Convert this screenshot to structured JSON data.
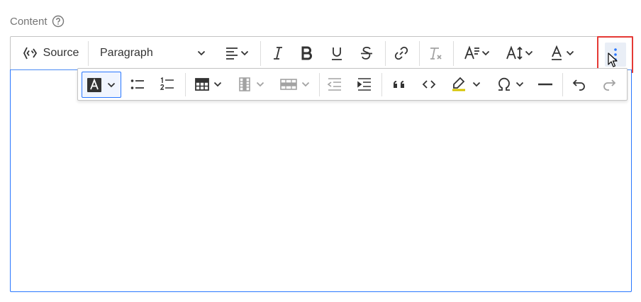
{
  "field": {
    "label": "Content",
    "help_icon": "question-circle-icon"
  },
  "toolbar": {
    "source_label": "Source",
    "heading_value": "Paragraph",
    "items": [
      "source-editing",
      "heading",
      "alignment",
      "italic",
      "bold",
      "underline",
      "strikethrough",
      "link",
      "remove-format",
      "font-family",
      "font-size",
      "font-color",
      "show-more-items"
    ]
  },
  "overflow_toolbar": {
    "items": [
      "font-background-color",
      "bulleted-list",
      "numbered-list",
      "insert-table",
      "table-column",
      "table-row",
      "outdent",
      "indent",
      "block-quote",
      "code",
      "highlight",
      "special-characters",
      "horizontal-line",
      "undo",
      "redo"
    ]
  },
  "colors": {
    "focus_border": "#2977ff",
    "highlight_box": "#e53935",
    "icon": "#333333"
  }
}
